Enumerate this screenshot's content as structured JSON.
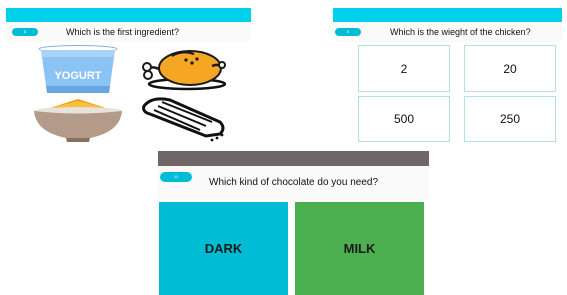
{
  "screen1": {
    "question_number": "8",
    "question": "Which is the first ingredient?",
    "options": [
      {
        "icon": "yogurt-icon",
        "label": "YOGURT"
      },
      {
        "icon": "roast-chicken-icon"
      },
      {
        "icon": "spice-bowl-icon"
      },
      {
        "icon": "grater-icon"
      }
    ]
  },
  "screen2": {
    "question_number": "9",
    "question": "Which is the wieght of the chicken?",
    "options": [
      "2",
      "20",
      "500",
      "250"
    ]
  },
  "screen3": {
    "question_number": "11",
    "question": "Which kind of chocolate do you need?",
    "options": [
      {
        "label": "DARK",
        "color": "#00bcd4"
      },
      {
        "label": "MILK",
        "color": "#4caf50"
      }
    ]
  },
  "colors": {
    "accent": "#00bcd4",
    "topbar_cyan": "#00d0ea",
    "topbar_gray": "#706868",
    "green": "#4caf50"
  }
}
